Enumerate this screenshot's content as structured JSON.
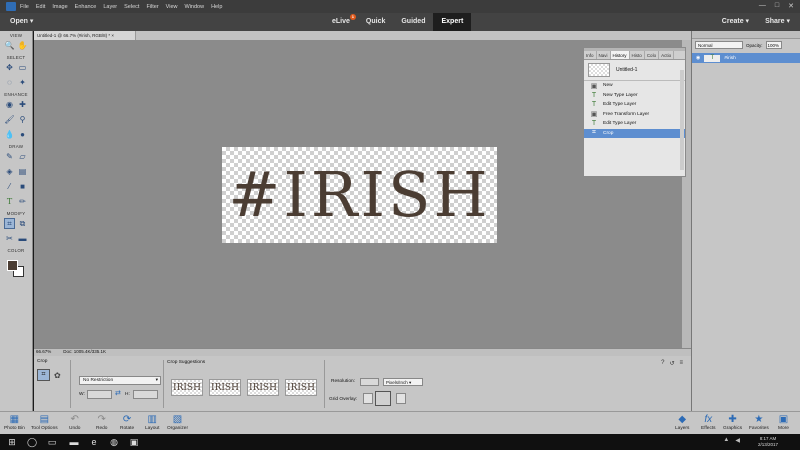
{
  "menu": {
    "items": [
      "File",
      "Edit",
      "Image",
      "Enhance",
      "Layer",
      "Select",
      "Filter",
      "View",
      "Window",
      "Help"
    ],
    "window_controls": [
      "—",
      "□",
      "✕"
    ]
  },
  "modebar": {
    "open_label": "Open",
    "tabs": [
      "eLive",
      "Quick",
      "Guided",
      "Expert"
    ],
    "elive_badge": "1",
    "create_label": "Create",
    "share_label": "Share"
  },
  "document": {
    "tab_title": "Untitled-1 @ 66.7% (#irish, RGB/8) *",
    "image_text": "#IRISH"
  },
  "toolbox": {
    "sections": [
      "VIEW",
      "SELECT",
      "ENHANCE",
      "DRAW",
      "MODIFY",
      "COLOR"
    ],
    "foreground_color": "#4b3d33",
    "background_color": "#ffffff"
  },
  "history": {
    "tabs": [
      "Info",
      "Navi",
      "History",
      "Histo",
      "Colo",
      "Actio"
    ],
    "snapshot_label": "Untitled-1",
    "steps": [
      "New",
      "New Type Layer",
      "Edit Type Layer",
      "Free Transform Layer",
      "Edit Type Layer",
      "Crop"
    ],
    "selected_step": "Crop"
  },
  "layers": {
    "blend_mode": "Normal",
    "opacity_label": "Opacity:",
    "opacity_value": "100%",
    "layer_name": "#irish",
    "layer_thumb": "T"
  },
  "status": {
    "zoom": "66.67%",
    "doc_size": "Doc: 1005.4K/335.1K"
  },
  "tool_options": {
    "section_label": "Crop",
    "preset": "No Restriction",
    "w_label": "W:",
    "h_label": "H:",
    "suggestions_label": "Crop Suggestions",
    "suggestions": [
      "IRISH",
      "IRISH",
      "IRISH",
      "IRISH"
    ],
    "resolution_label": "Resolution:",
    "resolution_unit": "Pixels/Inch",
    "grid_overlay_label": "Grid Overlay:"
  },
  "bottom_bar": {
    "left": [
      "Photo Bin",
      "Tool Options",
      "Undo",
      "Redo",
      "Rotate",
      "Layout",
      "Organizer"
    ],
    "right": [
      "Layers",
      "Effects",
      "Graphics",
      "Favorites",
      "More"
    ]
  },
  "taskbar": {
    "time": "8:17 AM",
    "date": "2/13/2017"
  }
}
